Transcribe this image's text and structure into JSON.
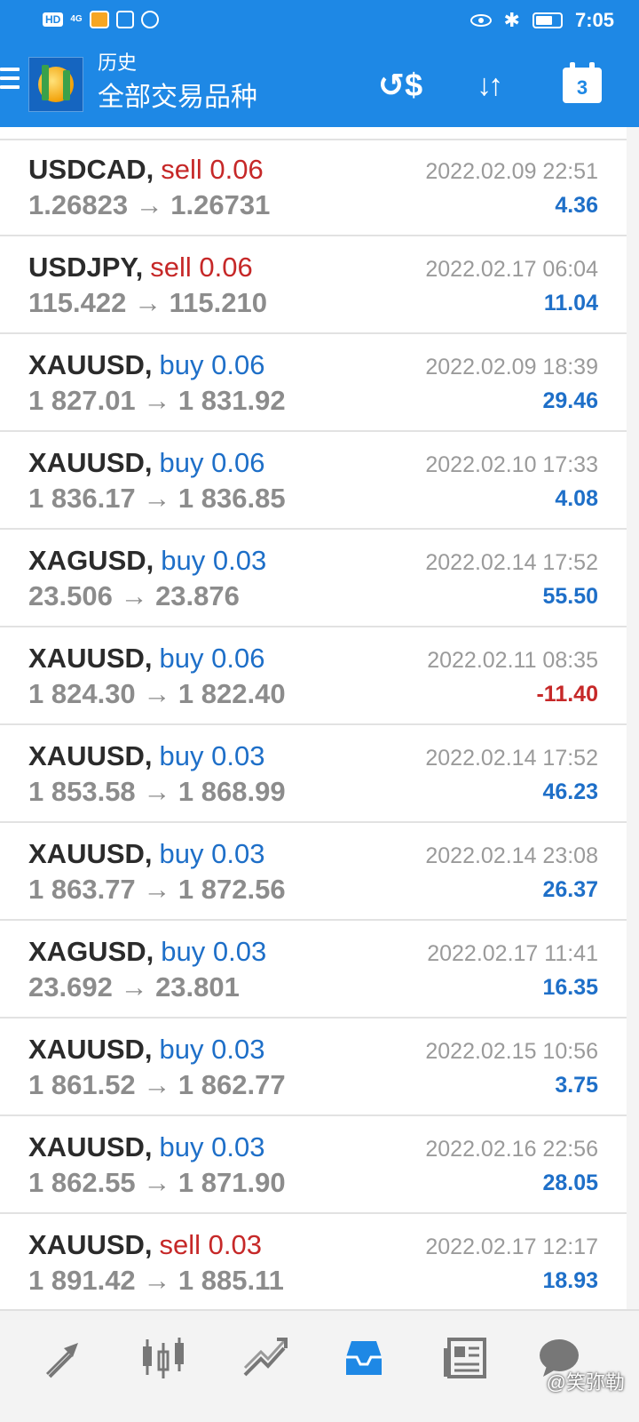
{
  "status_bar": {
    "left_badge": "HD",
    "network": "4G",
    "time": "7:05"
  },
  "header": {
    "title_small": "历史",
    "title_big": "全部交易品种",
    "icons": [
      "dollar-exchange-icon",
      "sort-icon",
      "calendar-icon"
    ],
    "calendar_day": "3"
  },
  "trades": [
    {
      "symbol": "USDCAD",
      "dir": "sell",
      "lot": "0.06",
      "open": "1.26823",
      "close": "1.26731",
      "datetime": "2022.02.09 22:51",
      "profit": "4.36"
    },
    {
      "symbol": "USDJPY",
      "dir": "sell",
      "lot": "0.06",
      "open": "115.422",
      "close": "115.210",
      "datetime": "2022.02.17 06:04",
      "profit": "11.04"
    },
    {
      "symbol": "XAUUSD",
      "dir": "buy",
      "lot": "0.06",
      "open": "1 827.01",
      "close": "1 831.92",
      "datetime": "2022.02.09 18:39",
      "profit": "29.46"
    },
    {
      "symbol": "XAUUSD",
      "dir": "buy",
      "lot": "0.06",
      "open": "1 836.17",
      "close": "1 836.85",
      "datetime": "2022.02.10 17:33",
      "profit": "4.08"
    },
    {
      "symbol": "XAGUSD",
      "dir": "buy",
      "lot": "0.03",
      "open": "23.506",
      "close": "23.876",
      "datetime": "2022.02.14 17:52",
      "profit": "55.50"
    },
    {
      "symbol": "XAUUSD",
      "dir": "buy",
      "lot": "0.06",
      "open": "1 824.30",
      "close": "1 822.40",
      "datetime": "2022.02.11 08:35",
      "profit": "-11.40"
    },
    {
      "symbol": "XAUUSD",
      "dir": "buy",
      "lot": "0.03",
      "open": "1 853.58",
      "close": "1 868.99",
      "datetime": "2022.02.14 17:52",
      "profit": "46.23"
    },
    {
      "symbol": "XAUUSD",
      "dir": "buy",
      "lot": "0.03",
      "open": "1 863.77",
      "close": "1 872.56",
      "datetime": "2022.02.14 23:08",
      "profit": "26.37"
    },
    {
      "symbol": "XAGUSD",
      "dir": "buy",
      "lot": "0.03",
      "open": "23.692",
      "close": "23.801",
      "datetime": "2022.02.17 11:41",
      "profit": "16.35"
    },
    {
      "symbol": "XAUUSD",
      "dir": "buy",
      "lot": "0.03",
      "open": "1 861.52",
      "close": "1 862.77",
      "datetime": "2022.02.15 10:56",
      "profit": "3.75"
    },
    {
      "symbol": "XAUUSD",
      "dir": "buy",
      "lot": "0.03",
      "open": "1 862.55",
      "close": "1 871.90",
      "datetime": "2022.02.16 22:56",
      "profit": "28.05"
    },
    {
      "symbol": "XAUUSD",
      "dir": "sell",
      "lot": "0.03",
      "open": "1 891.42",
      "close": "1 885.11",
      "datetime": "2022.02.17 12:17",
      "profit": "18.93"
    }
  ],
  "bottom_nav": {
    "items": [
      "quotes-icon",
      "chart-icon",
      "trade-icon",
      "history-icon",
      "news-icon",
      "chat-icon"
    ],
    "active": "history-icon"
  },
  "watermark": "@笑弥勒",
  "colors": {
    "primary": "#1e88e5",
    "sell": "#c62828",
    "buy": "#1e6fc8",
    "muted": "#8c8c8c"
  }
}
